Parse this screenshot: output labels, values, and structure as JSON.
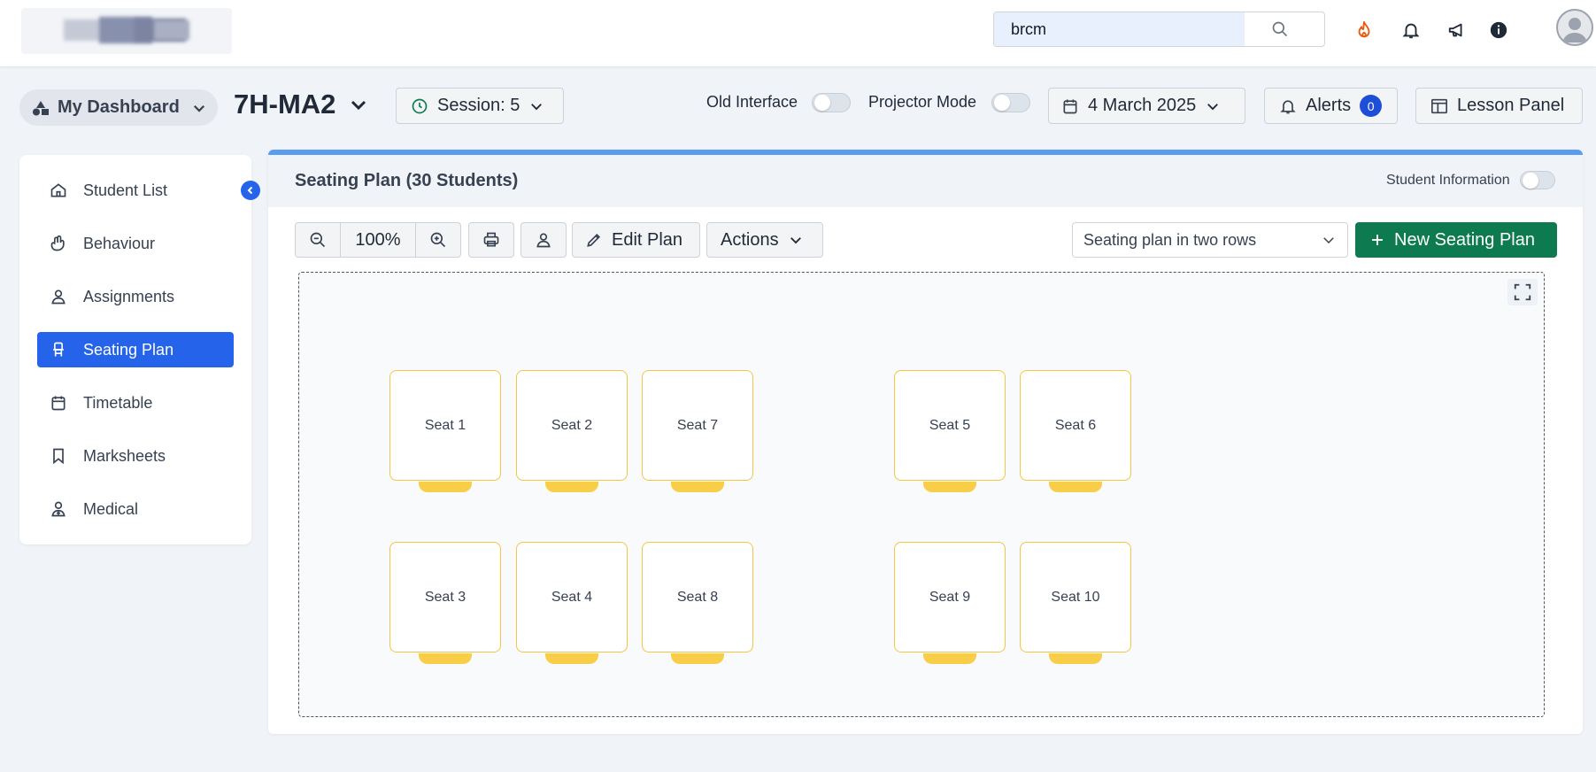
{
  "topbar": {
    "search": {
      "value": "brcm",
      "placeholder": ""
    },
    "icons": [
      "fire-icon",
      "bell-icon",
      "megaphone-icon",
      "info-icon",
      "user-avatar"
    ]
  },
  "header": {
    "dashboard_label": "My Dashboard",
    "class_name": "7H-MA2",
    "session_label": "Session: 5",
    "old_interface_label": "Old Interface",
    "projector_mode_label": "Projector Mode",
    "date_label": "4 March 2025",
    "alerts_label": "Alerts",
    "alerts_count": "0",
    "lesson_panel_label": "Lesson Panel"
  },
  "sidebar": {
    "items": [
      {
        "label": "Student List",
        "icon": "home-icon"
      },
      {
        "label": "Behaviour",
        "icon": "hands-icon"
      },
      {
        "label": "Assignments",
        "icon": "person-icon"
      },
      {
        "label": "Seating Plan",
        "icon": "chair-icon",
        "active": true
      },
      {
        "label": "Timetable",
        "icon": "calendar-icon"
      },
      {
        "label": "Marksheets",
        "icon": "bookmark-icon"
      },
      {
        "label": "Medical",
        "icon": "medical-icon"
      }
    ]
  },
  "panel": {
    "title": "Seating Plan (30 Students)",
    "student_info_label": "Student Information",
    "zoom_value": "100%",
    "edit_plan_label": "Edit Plan",
    "actions_label": "Actions",
    "layout_select": "Seating plan in two rows",
    "new_plan_label": "New Seating Plan"
  },
  "seats": [
    "Seat 1",
    "Seat 2",
    "Seat 7",
    "Seat 5",
    "Seat 6",
    "Seat 3",
    "Seat 4",
    "Seat 8",
    "Seat 9",
    "Seat 10"
  ],
  "colors": {
    "primary": "#2563eb",
    "new_button": "#0e7a4f",
    "seat_border": "#f4c542",
    "chair": "#f8cd48",
    "fire": "#ea580c"
  }
}
